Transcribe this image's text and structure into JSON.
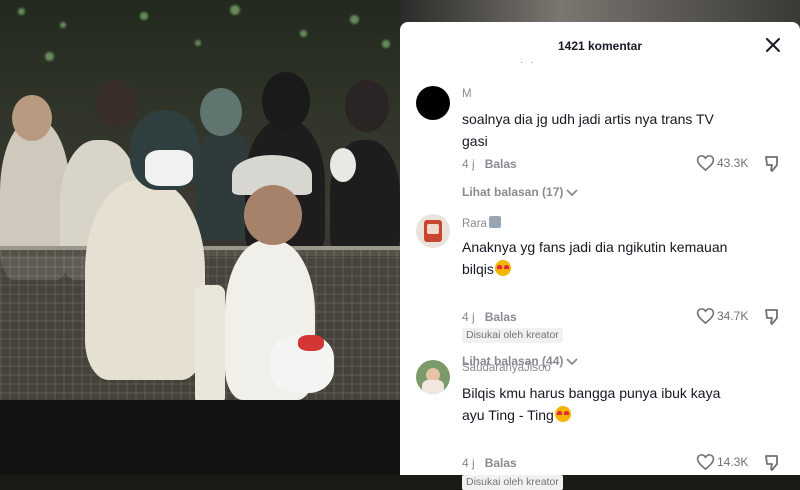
{
  "panel": {
    "title": "1421 komentar"
  },
  "comments": [
    {
      "username": "M",
      "text": "soalnya dia jg udh jadi artis nya trans TV gasi",
      "time": "4 j",
      "reply_label": "Balas",
      "likes": "43.3K",
      "view_replies": "Lihat balasan (17)",
      "liked_by_creator": ""
    },
    {
      "username": "Rara",
      "text": "Anaknya yg fans jadi dia ngikutin kemauan bilqis",
      "time": "4 j",
      "reply_label": "Balas",
      "likes": "34.7K",
      "liked_by_creator": "Disukai oleh kreator",
      "view_replies": "Lihat balasan (44)"
    },
    {
      "username": "SaudaranyaJisoo",
      "text": "Bilqis kmu harus bangga punya ibuk kaya ayu Ting - Ting",
      "time": "4 j",
      "reply_label": "Balas",
      "likes": "14.3K",
      "liked_by_creator": "Disukai oleh kreator"
    }
  ],
  "icons": {
    "close": "close-icon",
    "like": "heart-icon",
    "dislike": "thumbs-down-icon",
    "expand": "chevron-down-icon"
  },
  "colors": {
    "text_primary": "#161823",
    "text_secondary": "#8a8b91",
    "panel_bg": "#ffffff"
  }
}
